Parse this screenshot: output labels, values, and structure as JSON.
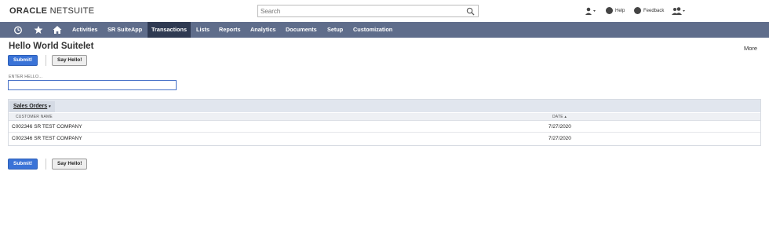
{
  "header": {
    "logo_oracle": "ORACLE",
    "logo_netsuite": "NETSUITE",
    "search_placeholder": "Search",
    "help_label": "Help",
    "feedback_label": "Feedback"
  },
  "nav": {
    "items": [
      "Activities",
      "SR SuiteApp",
      "Transactions",
      "Lists",
      "Reports",
      "Analytics",
      "Documents",
      "Setup",
      "Customization"
    ],
    "active": "Transactions"
  },
  "page": {
    "title": "Hello World Suitelet",
    "more_label": "More",
    "submit_label": "Submit!",
    "say_hello_label": "Say Hello!",
    "field_label": "ENTER HELLO...",
    "field_value": ""
  },
  "sublist": {
    "tab_label": "Sales Orders",
    "columns": [
      "CUSTOMER NAME",
      "DATE ▴"
    ],
    "rows": [
      [
        "C002346 SR TEST COMPANY",
        "7/27/2020"
      ],
      [
        "C002346 SR TEST COMPANY",
        "7/27/2020"
      ]
    ]
  },
  "colors": {
    "nav_bg": "#5f6d8b",
    "nav_active": "#2f3a52",
    "primary_button": "#3a73d7"
  }
}
